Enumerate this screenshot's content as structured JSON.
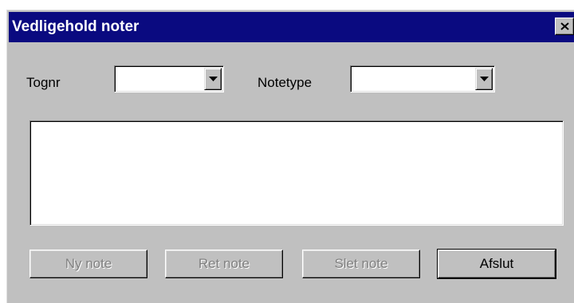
{
  "window": {
    "title": "Vedligehold noter"
  },
  "fields": {
    "tognr_label": "Tognr",
    "tognr_value": "",
    "notetype_label": "Notetype",
    "notetype_value": ""
  },
  "notes": {
    "text": ""
  },
  "buttons": {
    "new_note": "Ny note",
    "edit_note": "Ret note",
    "delete_note": "Slet note",
    "exit": "Afslut"
  },
  "icons": {
    "close": "close-icon",
    "dropdown": "chevron-down-icon"
  },
  "colors": {
    "titlebar": "#0a0a80",
    "window_face": "#c0c0c0",
    "disabled_text": "#808080"
  }
}
